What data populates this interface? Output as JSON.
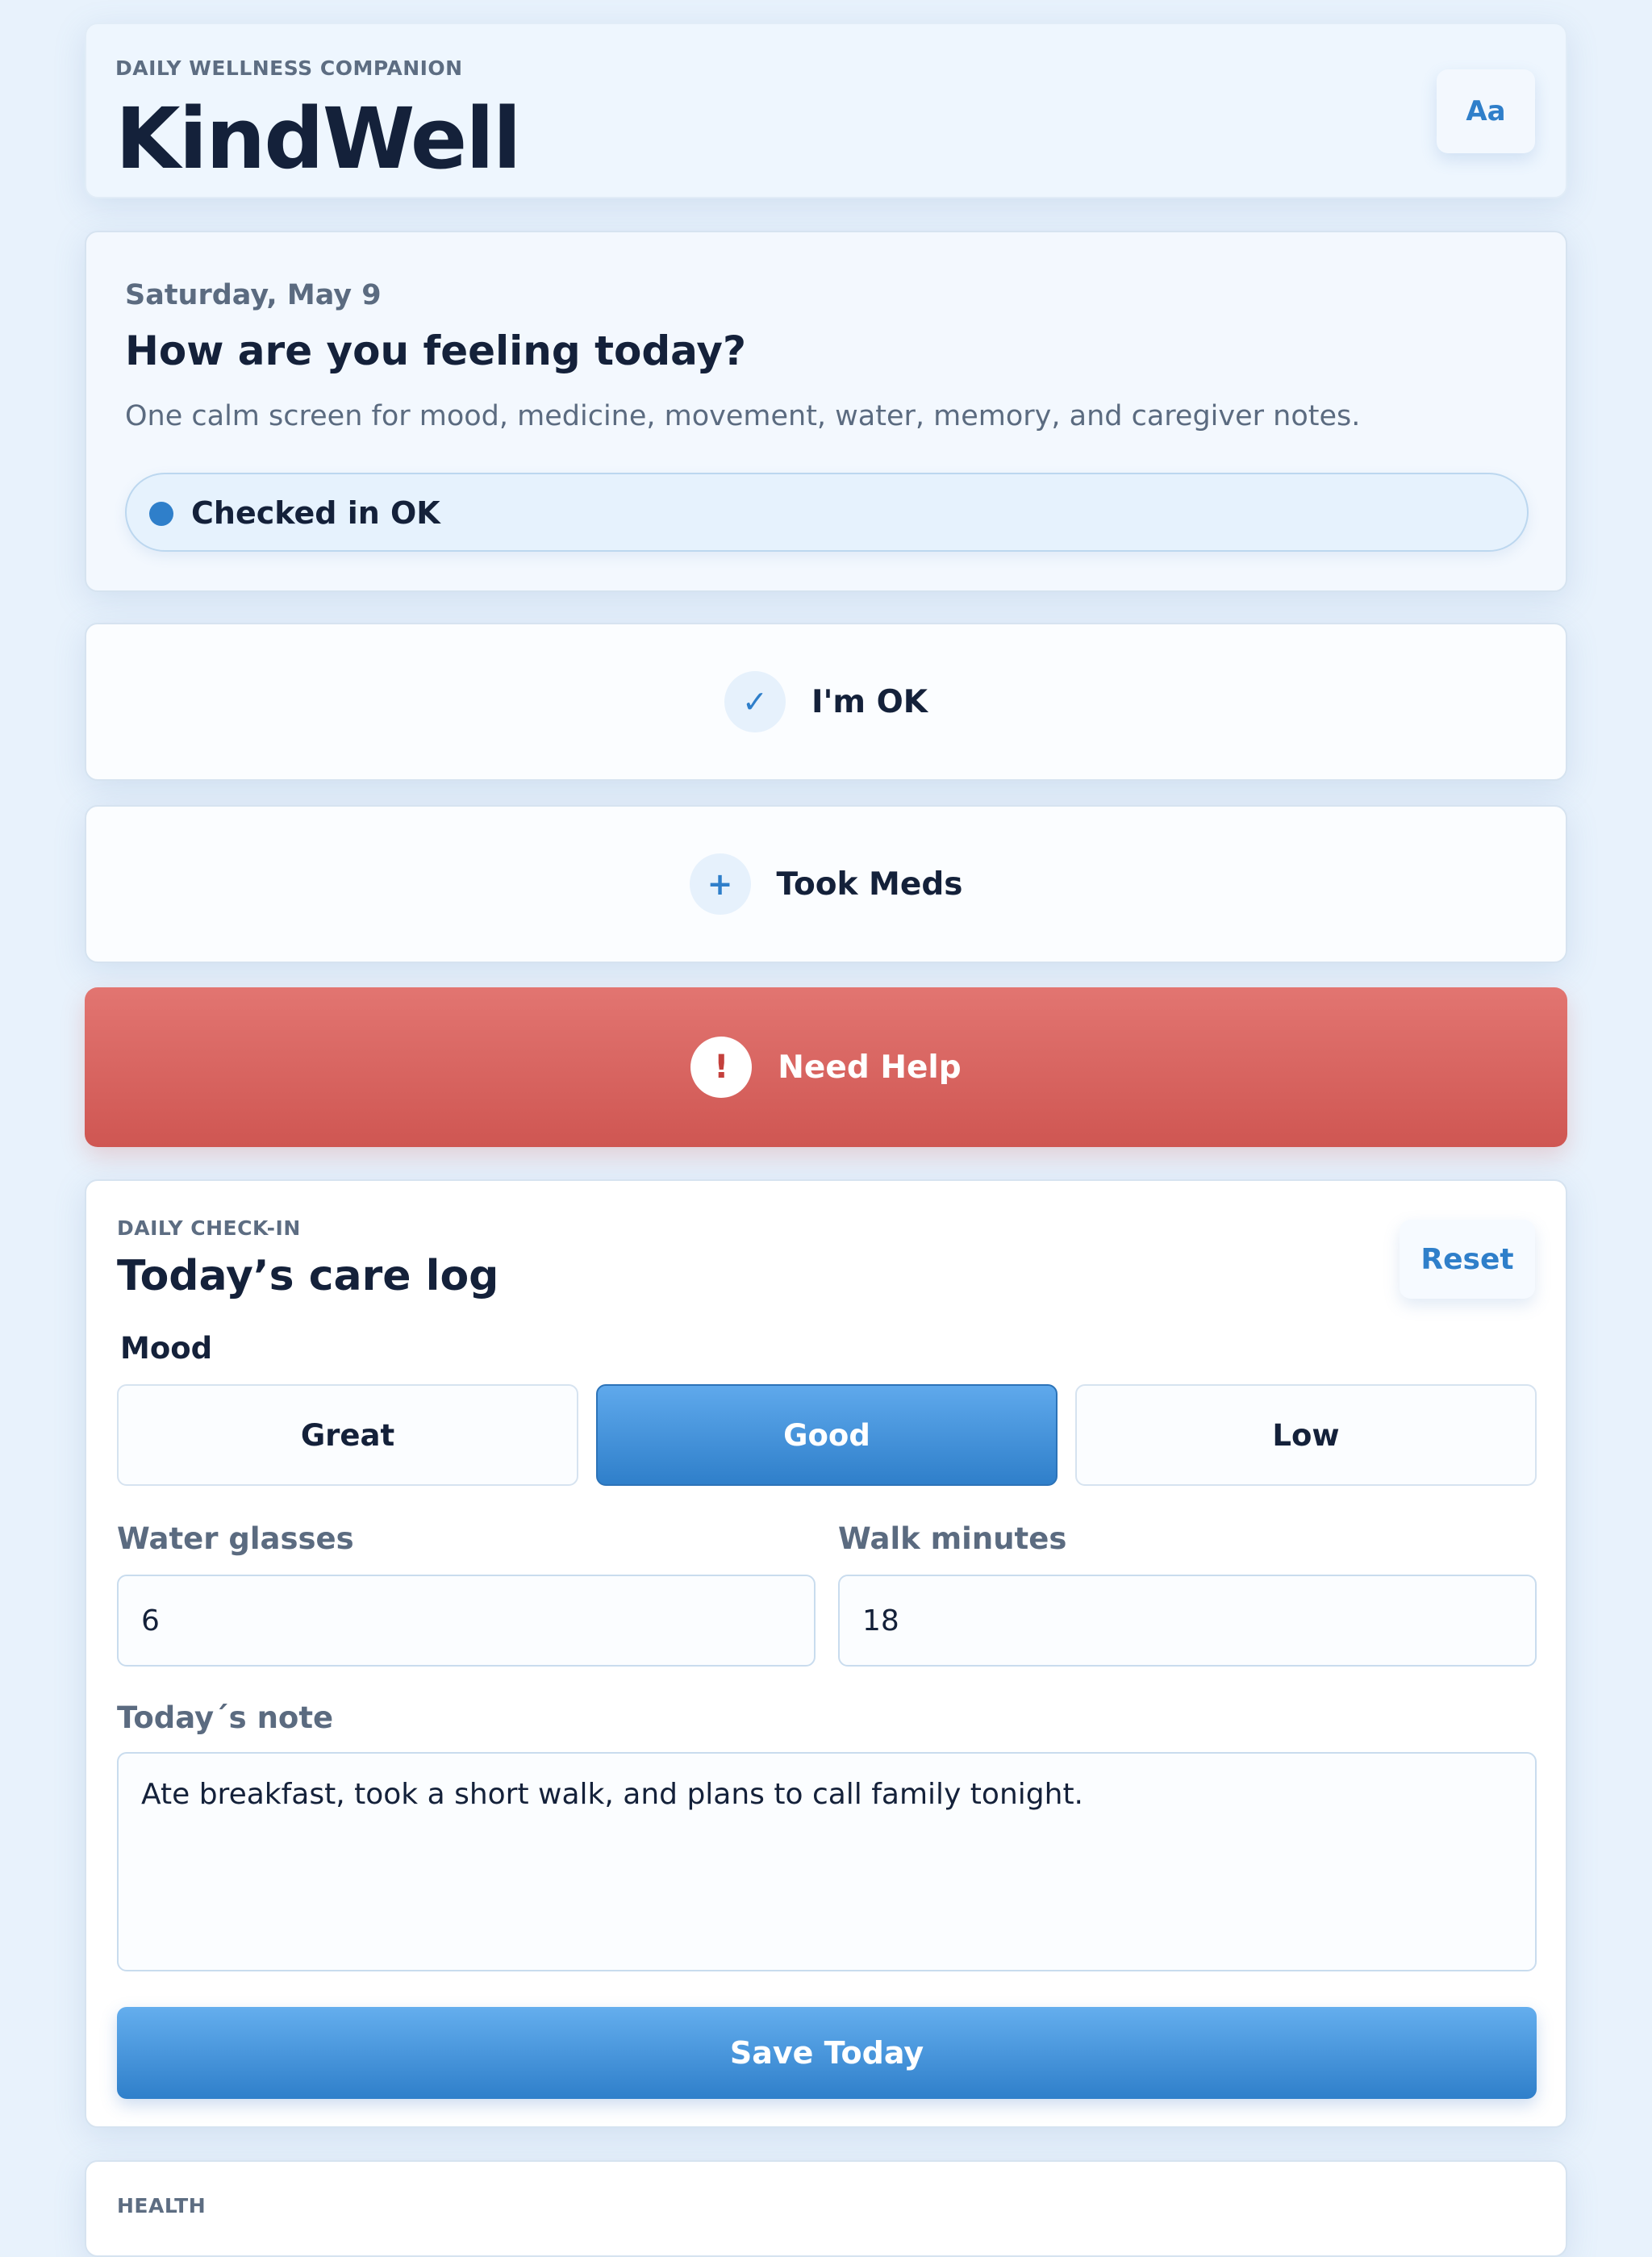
{
  "header": {
    "eyebrow": "DAILY WELLNESS COMPANION",
    "title": "KindWell",
    "font_button": "Aa"
  },
  "greeting": {
    "date": "Saturday, May 9",
    "question": "How are you feeling today?",
    "subtitle": "One calm screen for mood, medicine, movement, water, memory, and caregiver notes.",
    "status": "Checked in OK"
  },
  "actions": {
    "ok": {
      "icon": "✓",
      "label": "I'm OK"
    },
    "meds": {
      "icon": "+",
      "label": "Took Meds"
    },
    "help": {
      "icon": "!",
      "label": "Need Help"
    }
  },
  "care_log": {
    "eyebrow": "DAILY CHECK-IN",
    "title": "Today’s care log",
    "reset_label": "Reset",
    "mood_label": "Mood",
    "mood_options": [
      "Great",
      "Good",
      "Low"
    ],
    "mood_selected": "Good",
    "water_label": "Water glasses",
    "water_value": "6",
    "walk_label": "Walk minutes",
    "walk_value": "18",
    "note_label": "Today´s note",
    "note_value": "Ate breakfast, took a short walk, and plans to call family tonight.",
    "save_label": "Save Today"
  },
  "next_section": {
    "eyebrow": "HEALTH"
  },
  "colors": {
    "accent": "#2f7fca",
    "danger": "#d65b57",
    "background": "#e8f2fc",
    "text": "#14213a"
  }
}
